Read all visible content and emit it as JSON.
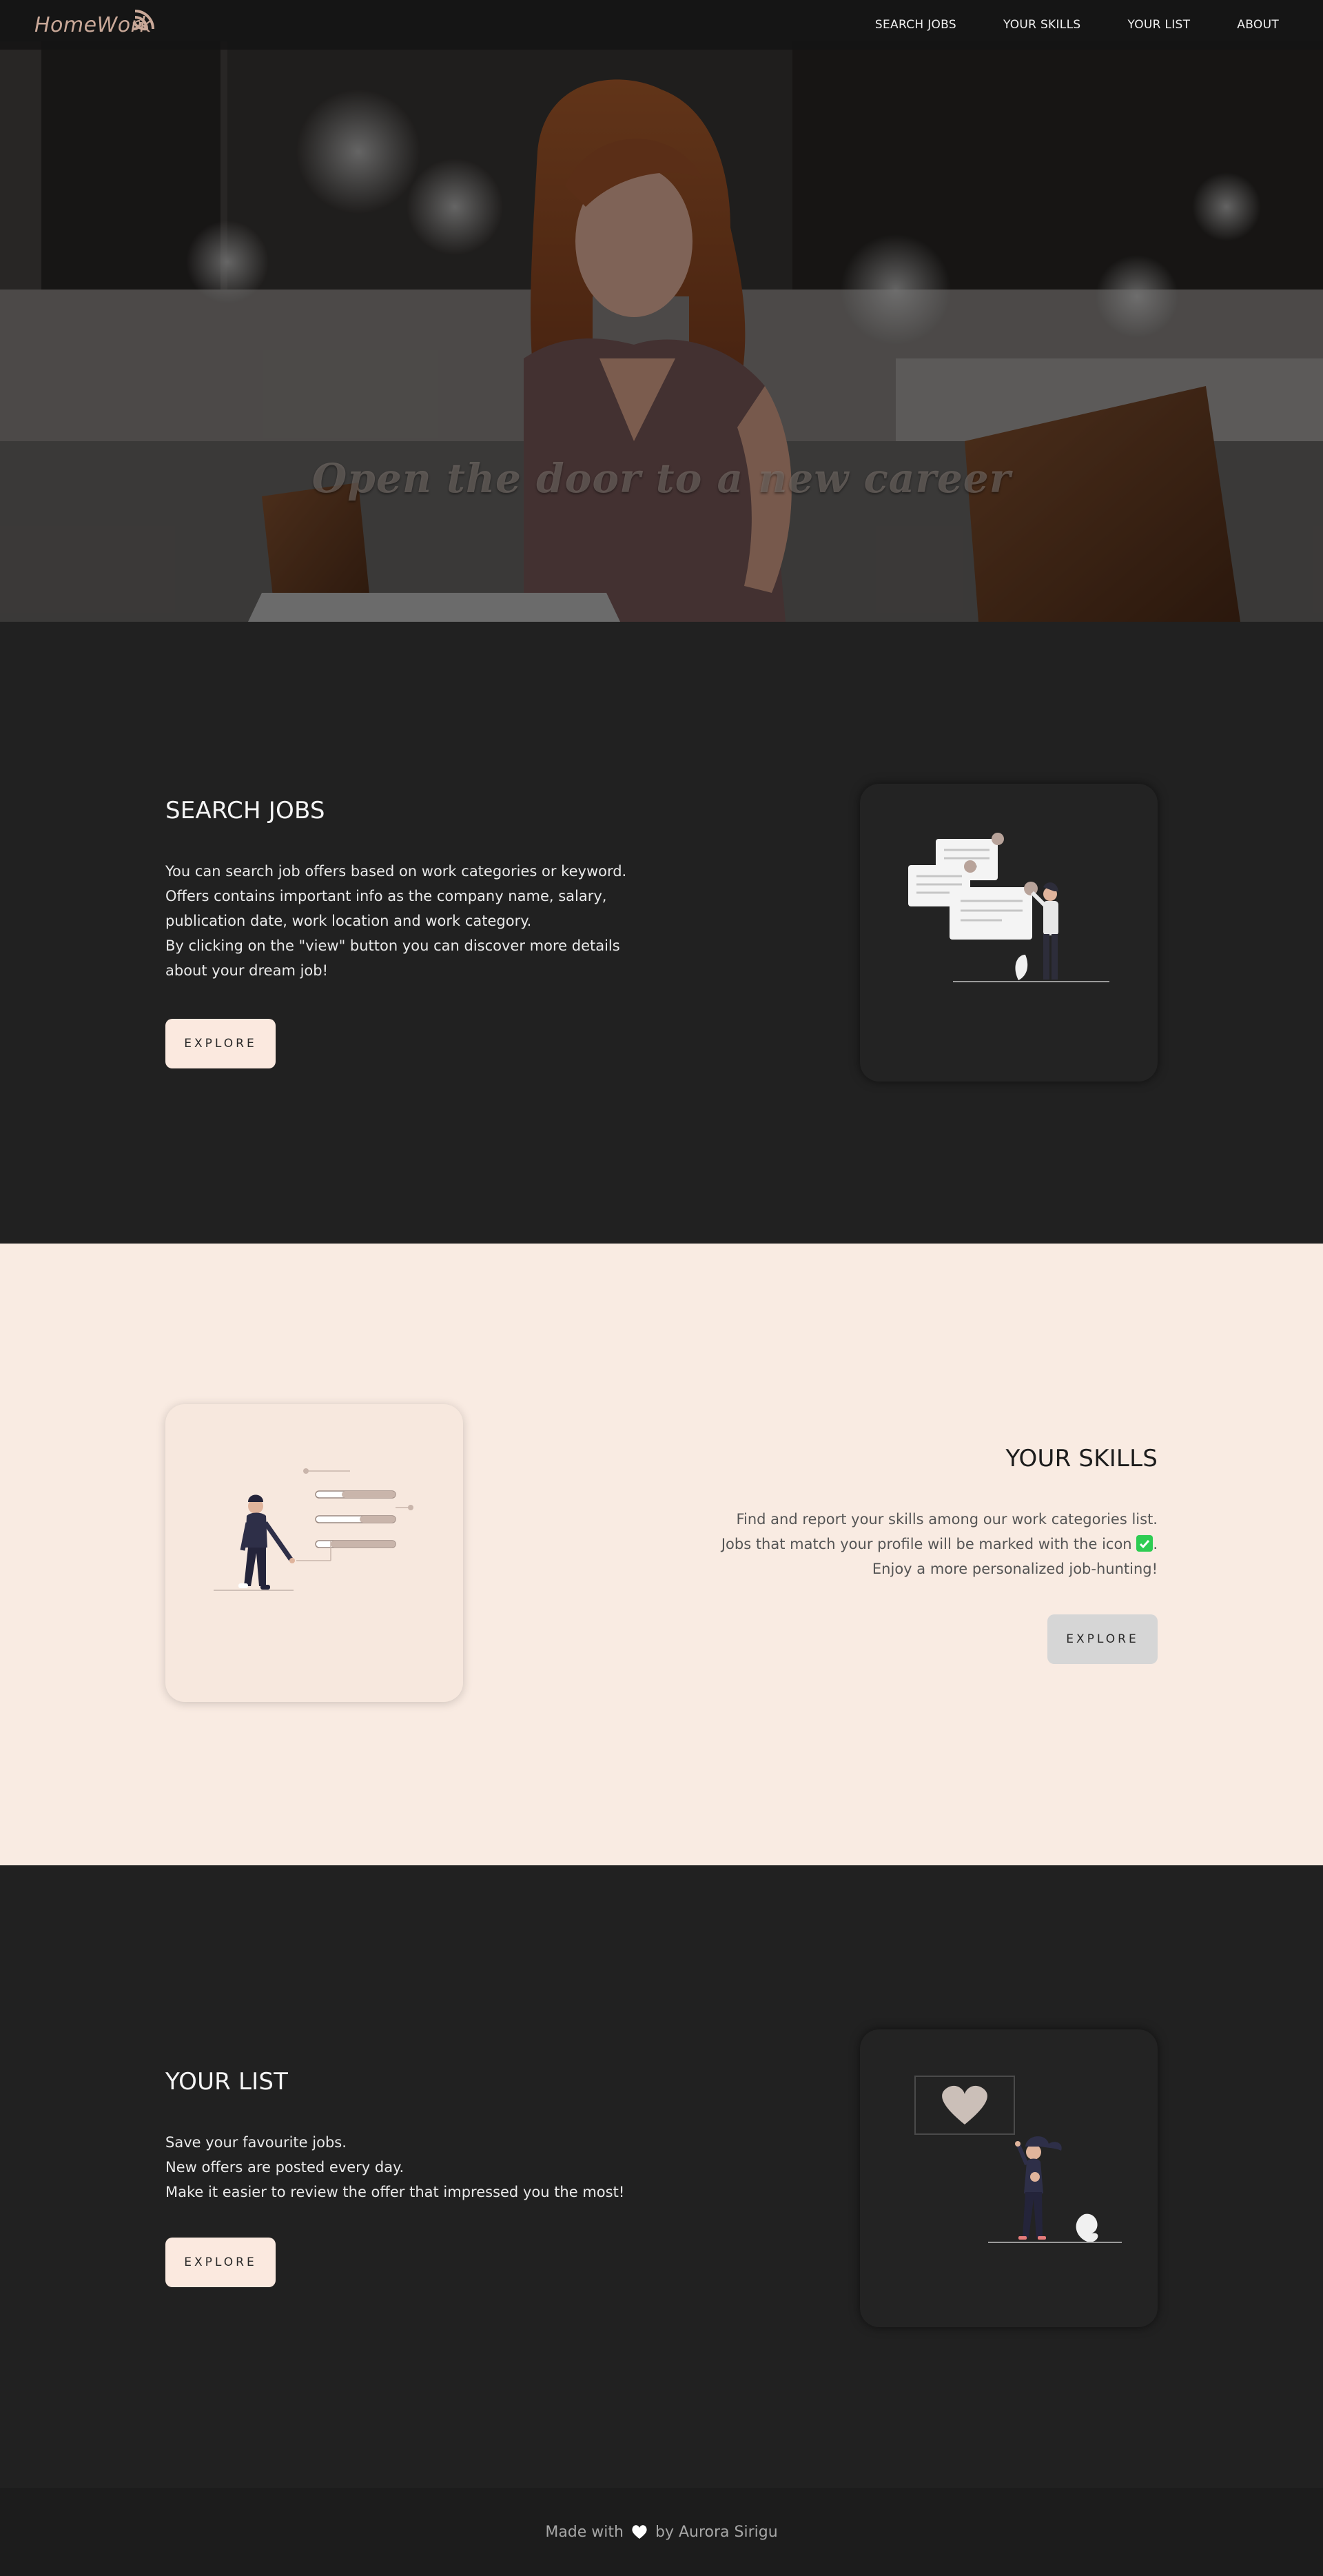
{
  "brand": {
    "logo_text": "HomeWork"
  },
  "nav": {
    "items": [
      {
        "label": "SEARCH JOBS"
      },
      {
        "label": "YOUR SKILLS"
      },
      {
        "label": "YOUR LIST"
      },
      {
        "label": "ABOUT"
      }
    ]
  },
  "hero": {
    "title": "Open the door to a new career"
  },
  "search_jobs": {
    "title": "SEARCH JOBS",
    "paragraphs": [
      "You can search job offers based on work categories or keyword.",
      "Offers contains important info as the company name, salary,",
      "publication date, work location and work category.",
      "By clicking on the \"view\" button you can discover more details",
      "about your dream job!"
    ],
    "button_label": "EXPLORE"
  },
  "your_skills": {
    "title": "YOUR SKILLS",
    "line1": "Find and report your skills among our work categories list.",
    "line2": "Jobs that match your profile will be marked with the icon",
    "line2_end": ".",
    "line3": "Enjoy a more personalized job-hunting!",
    "button_label": "EXPLORE"
  },
  "your_list": {
    "title": "YOUR LIST",
    "paragraphs": [
      "Save your favourite jobs.",
      "New offers are posted every day.",
      "Make it easier to review the offer that impressed you the most!"
    ],
    "button_label": "EXPLORE"
  },
  "footer": {
    "prefix": "Made with",
    "suffix": "by Aurora Sirigu"
  },
  "colors": {
    "dark_bg": "#212121",
    "light_bg": "#f9ebe2",
    "accent": "#c9a898",
    "check_green": "#2ecc52"
  },
  "icons": [
    "logo-waves-icon",
    "documents-illustration",
    "skills-illustration",
    "heart-illustration",
    "check-icon",
    "heart-icon"
  ]
}
